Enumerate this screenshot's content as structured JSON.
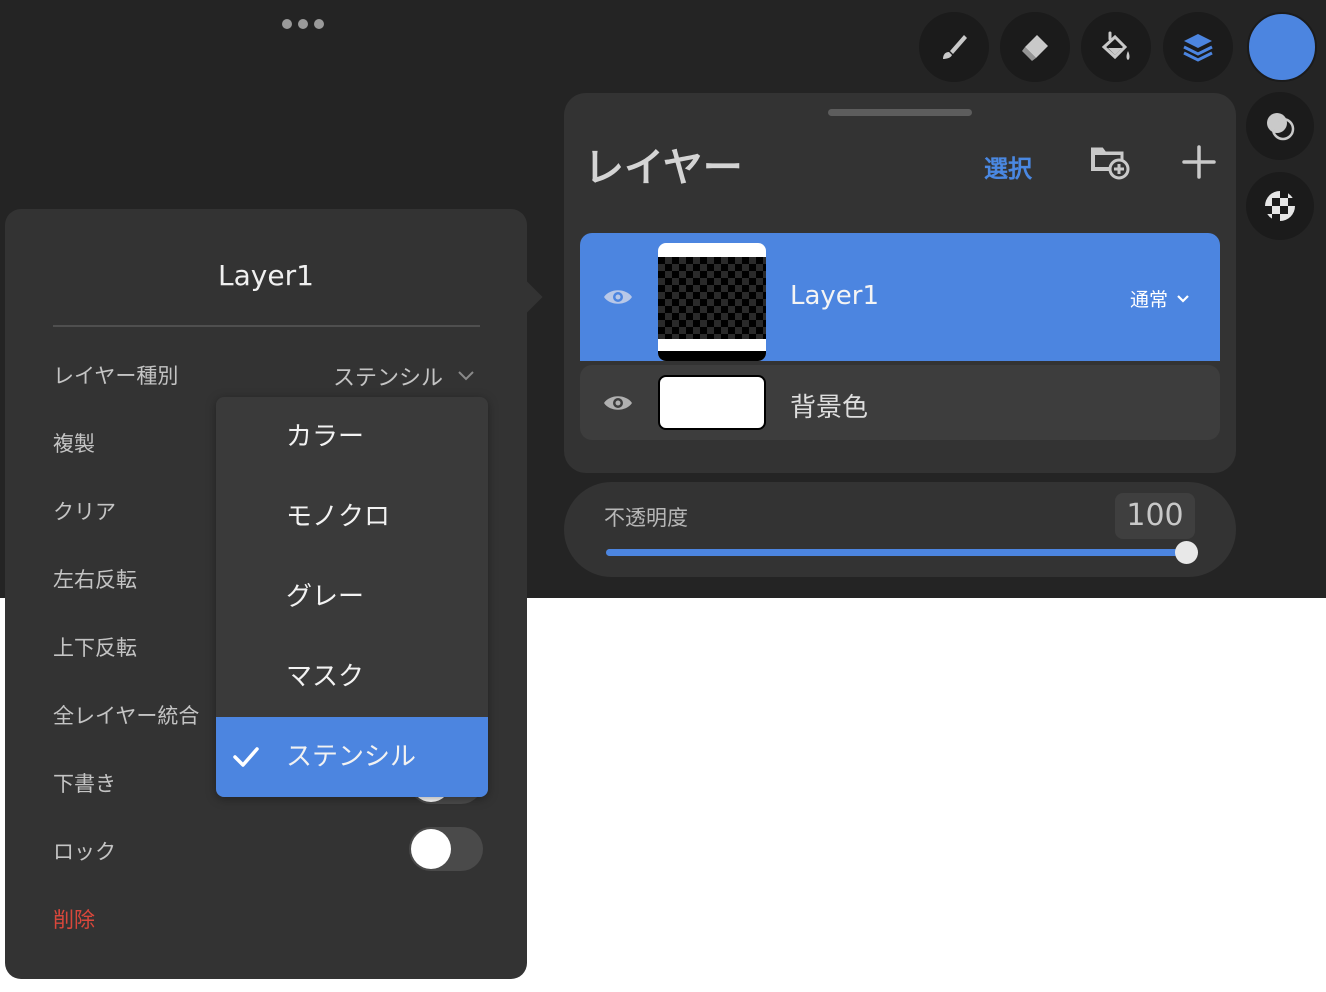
{
  "colors": {
    "accent": "#4c85e0",
    "danger": "#d9473b",
    "current_color": "#4c85e0",
    "background_dark": "#242424",
    "panel": "#333333"
  },
  "toolbar": {
    "tools": [
      {
        "name": "brush-icon"
      },
      {
        "name": "eraser-icon"
      },
      {
        "name": "fill-bucket-icon"
      },
      {
        "name": "layers-icon"
      }
    ],
    "side_tools": [
      {
        "name": "blend-icon"
      },
      {
        "name": "checker-icon"
      }
    ]
  },
  "layers_panel": {
    "title": "レイヤー",
    "select_label": "選択",
    "layers": [
      {
        "name": "Layer1",
        "blend_mode": "通常",
        "selected": true
      },
      {
        "name": "背景色",
        "selected": false
      }
    ],
    "opacity_label": "不透明度",
    "opacity_value": "100",
    "opacity_fraction": 1.0
  },
  "layer_options": {
    "title": "Layer1",
    "type_label": "レイヤー種別",
    "type_value": "ステンシル",
    "items": {
      "duplicate": "複製",
      "clear": "クリア",
      "flip_h": "左右反転",
      "flip_v": "上下反転",
      "merge_all": "全レイヤー統合",
      "draft": "下書き",
      "lock": "ロック",
      "delete": "削除"
    },
    "draft_on": false,
    "lock_on": false
  },
  "type_dropdown": {
    "options": [
      "カラー",
      "モノクロ",
      "グレー",
      "マスク",
      "ステンシル"
    ],
    "selected": "ステンシル"
  }
}
